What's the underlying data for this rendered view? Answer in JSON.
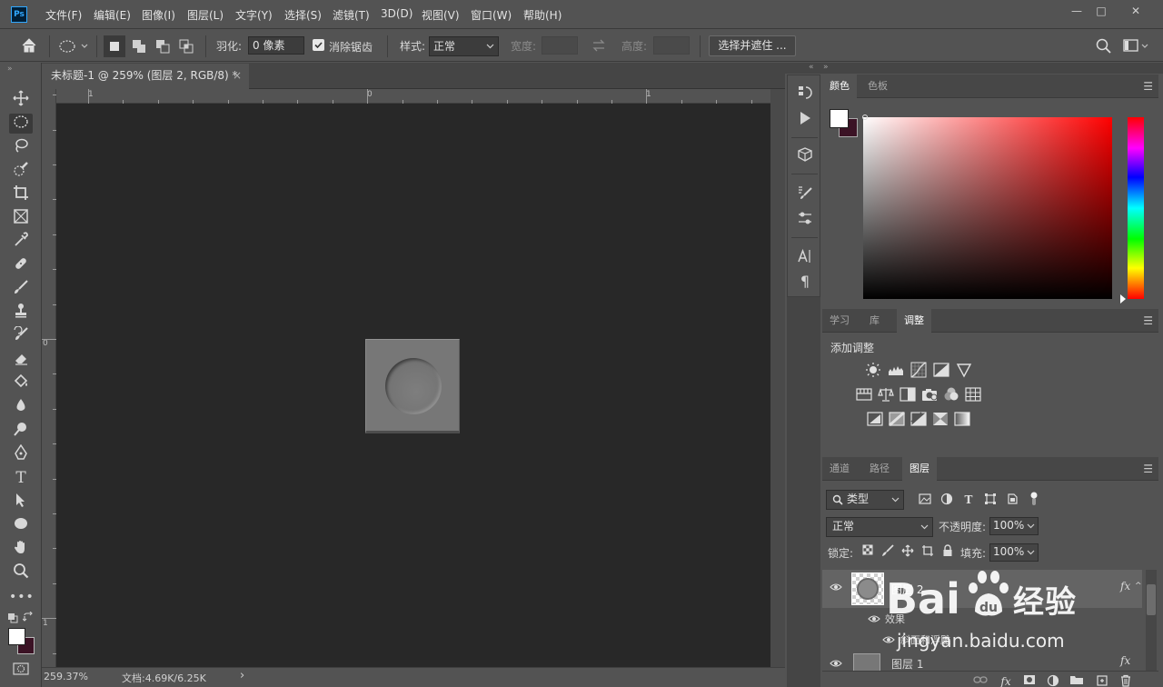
{
  "app": {
    "logo": "Ps",
    "menu": [
      "文件(F)",
      "编辑(E)",
      "图像(I)",
      "图层(L)",
      "文字(Y)",
      "选择(S)",
      "滤镜(T)",
      "3D(D)",
      "视图(V)",
      "窗口(W)",
      "帮助(H)"
    ],
    "window_controls": {
      "minimize": "—",
      "maximize": "□",
      "close": "✕"
    }
  },
  "options": {
    "feather_label": "羽化:",
    "feather_value": "0 像素",
    "antialias_label": "消除锯齿",
    "style_label": "样式:",
    "style_value": "正常",
    "width_label": "宽度:",
    "height_label": "高度:",
    "select_mask_button": "选择并遮住 ..."
  },
  "document": {
    "tab_title": "未标题-1 @ 259% (图层 2, RGB/8) *",
    "tab_close": "×",
    "ruler_h": [
      "1",
      "0",
      "1"
    ],
    "ruler_v": [
      "0",
      "1"
    ],
    "zoom": "259.37%",
    "doc_size": "文档:4.69K/6.25K",
    "status_arrow": "›"
  },
  "colors": {
    "foreground": "#ffffff",
    "background": "#3b1325",
    "canvas_bg": "#282828",
    "panel_bg": "#535353"
  },
  "color_panel": {
    "tabs": [
      "颜色",
      "色板"
    ]
  },
  "adjust_panel": {
    "tabs": [
      "学习",
      "库",
      "调整"
    ],
    "title": "添加调整"
  },
  "layers_panel": {
    "tabs": [
      "通道",
      "路径",
      "图层"
    ],
    "filter_kind": "类型",
    "blend_mode": "正常",
    "opacity_label": "不透明度:",
    "opacity_value": "100%",
    "lock_label": "锁定:",
    "fill_label": "填充:",
    "fill_value": "100%",
    "layers": [
      {
        "name": "图层 2",
        "fx": "fx"
      },
      {
        "name": "效果"
      },
      {
        "name": "斜面和浮雕"
      },
      {
        "name": "图层 1",
        "fx": "fx"
      }
    ]
  },
  "watermark": {
    "brand": "Baidu",
    "brand_cn": "经验",
    "url": "jingyan.baidu.com"
  }
}
